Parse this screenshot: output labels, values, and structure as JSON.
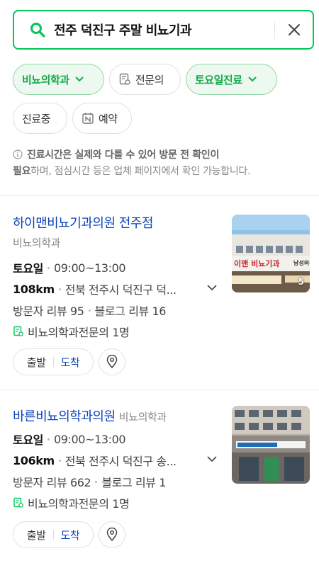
{
  "search": {
    "query": "전주 덕진구 주말 비뇨기과"
  },
  "filters": {
    "chip1": "비뇨의학과",
    "chip2": "전문의",
    "chip3": "토요일진료",
    "chip4": "진료중",
    "chip5": "예약"
  },
  "notice": {
    "bold1": "진료시간은 실제와 다를 수 있어 방문 전 확인이",
    "bold2": "필요",
    "rest": "하며, 점심시간 등은 업체 페이지에서 확인 가능합니다."
  },
  "results": [
    {
      "name": "하이맨비뇨기과의원 전주점",
      "category": "비뇨의학과",
      "day": "토요일",
      "hours": "09:00~13:00",
      "distance": "108km",
      "address": "전북 전주시 덕진구 덕...",
      "visitor_reviews": "방문자 리뷰 95",
      "blog_reviews": "블로그 리뷰 16",
      "specialist": "비뇨의학과전문의 1명",
      "photo_count": "5",
      "sign_text": "이맨 비뇨기과",
      "sign_sub": "남성의원"
    },
    {
      "name": "바른비뇨의학과의원",
      "category": "비뇨의학과",
      "day": "토요일",
      "hours": "09:00~13:00",
      "distance": "106km",
      "address": "전북 전주시 덕진구 송...",
      "visitor_reviews": "방문자 리뷰 662",
      "blog_reviews": "블로그 리뷰 1",
      "specialist": "비뇨의학과전문의 1명"
    }
  ],
  "buttons": {
    "depart": "출발",
    "arrive": "도착"
  },
  "colors": {
    "accent": "#03c75a",
    "link": "#0c43b7"
  }
}
